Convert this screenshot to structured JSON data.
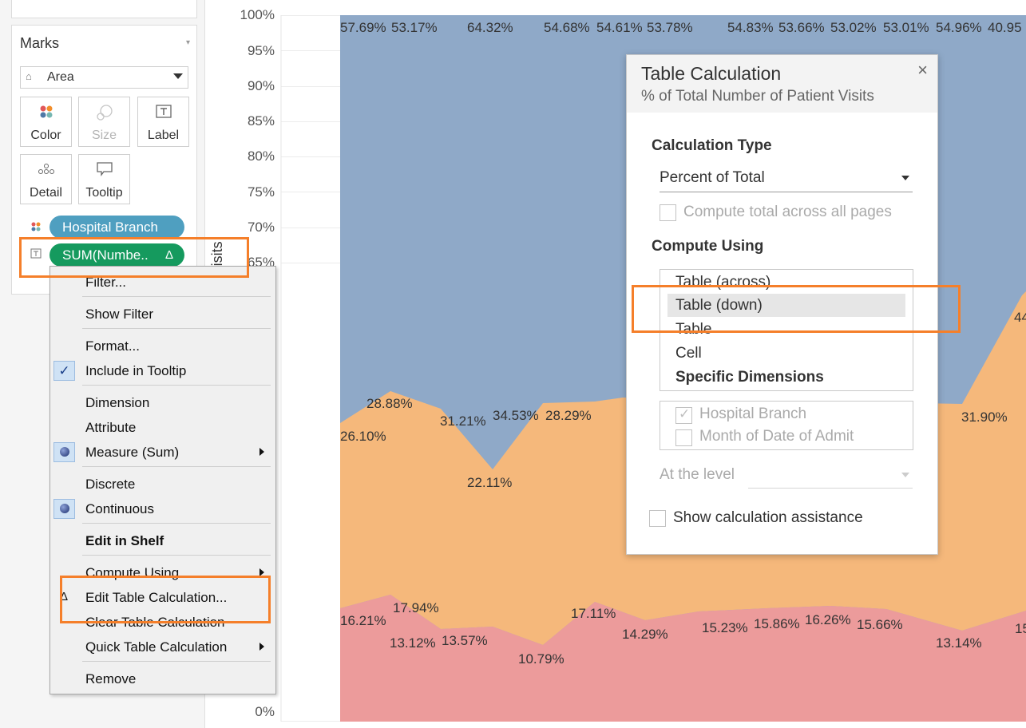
{
  "marks": {
    "title": "Marks",
    "mark_type": "Area",
    "buttons": {
      "color": "Color",
      "size": "Size",
      "label": "Label",
      "detail": "Detail",
      "tooltip": "Tooltip"
    },
    "pills": {
      "branch": "Hospital Branch",
      "sum": "SUM(Numbe..",
      "delta": "Δ"
    }
  },
  "chart": {
    "y_ticks": [
      "100%",
      "95%",
      "90%",
      "85%",
      "80%",
      "75%",
      "70%",
      "65%",
      "0%"
    ],
    "y_axis_label": "Visits",
    "colors": {
      "top": "#8fa9c8",
      "mid": "#f5b87b",
      "bottom": "#ec9b9b"
    }
  },
  "chart_data": {
    "type": "area",
    "stacked": "percent",
    "ylim": [
      0,
      100
    ],
    "series": [
      {
        "name": "top",
        "color": "#8fa9c8",
        "labels": [
          "57.69%",
          "53.17%",
          "64.32%",
          "54.68%",
          "54.61%",
          "53.78%",
          "54.83%",
          "53.66%",
          "53.02%",
          "53.01%",
          "54.96%",
          "40.95"
        ]
      },
      {
        "name": "middle",
        "color": "#f5b87b",
        "labels": [
          "26.10%",
          "28.88%",
          "31.21%",
          "22.11%",
          "34.53%",
          "28.29%",
          "31.90%",
          "44"
        ]
      },
      {
        "name": "bottom",
        "color": "#ec9b9b",
        "labels": [
          "16.21%",
          "17.94%",
          "13.12%",
          "13.57%",
          "10.79%",
          "17.11%",
          "14.29%",
          "15.23%",
          "15.86%",
          "16.26%",
          "15.66%",
          "13.14%",
          "15"
        ]
      }
    ]
  },
  "context_menu": {
    "items": {
      "filter": "Filter...",
      "show_filter": "Show Filter",
      "format": "Format...",
      "include_tooltip": "Include in Tooltip",
      "dimension": "Dimension",
      "attribute": "Attribute",
      "measure": "Measure (Sum)",
      "discrete": "Discrete",
      "continuous": "Continuous",
      "edit_in_shelf": "Edit in Shelf",
      "compute_using": "Compute Using",
      "edit_table_calc": "Edit Table Calculation...",
      "clear_table_calc": "Clear Table Calculation",
      "quick_table_calc": "Quick Table Calculation",
      "remove": "Remove"
    },
    "check_glyph": "✓",
    "delta_glyph": "Δ"
  },
  "dialog": {
    "title": "Table Calculation",
    "subtitle": "% of Total Number of Patient Visits",
    "close": "×",
    "calc_type_heading": "Calculation Type",
    "calc_type_value": "Percent of Total",
    "compute_total_label": "Compute total across all pages",
    "compute_using_heading": "Compute Using",
    "compute_options": [
      "Table (across)",
      "Table (down)",
      "Table",
      "Cell",
      "Specific Dimensions"
    ],
    "selected_option": "Table (down)",
    "dims": [
      {
        "label": "Hospital Branch",
        "checked": true
      },
      {
        "label": "Month of Date of Admit",
        "checked": false
      }
    ],
    "level_label": "At the level",
    "show_assist_label": "Show calculation assistance"
  },
  "highlight_color": "#f57f2a"
}
